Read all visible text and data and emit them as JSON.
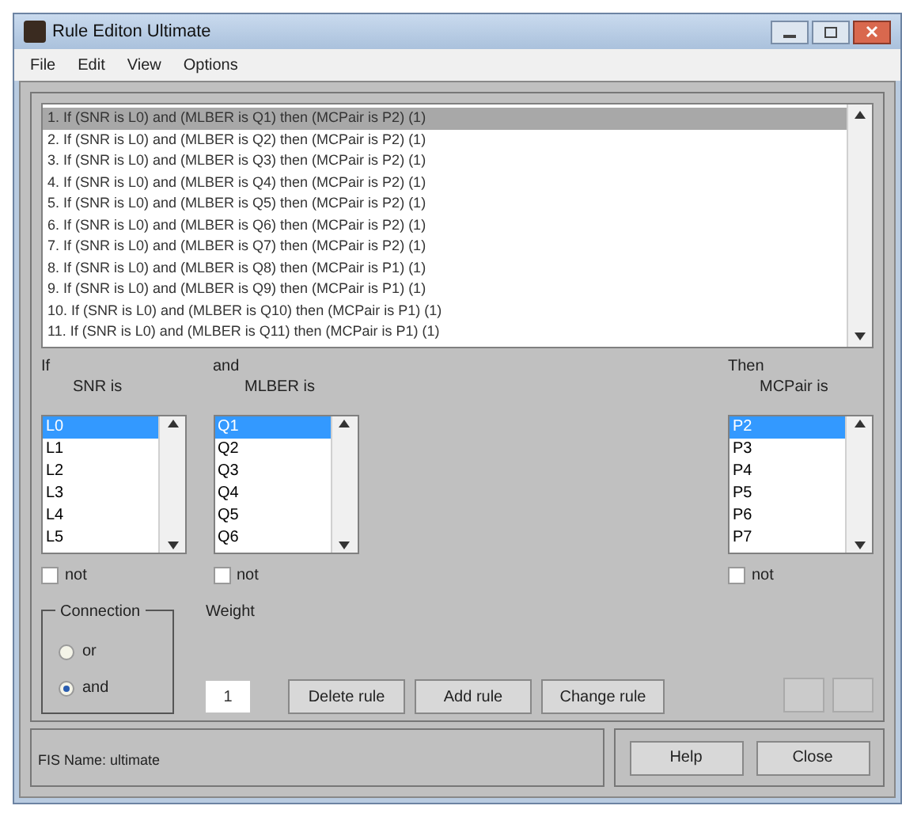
{
  "window": {
    "title": "Rule Editon Ultimate"
  },
  "menu": [
    "File",
    "Edit",
    "View",
    "Options"
  ],
  "rules": [
    {
      "text": "1. If (SNR is L0) and (MLBER is Q1) then (MCPair is P2) (1)",
      "selected": true
    },
    {
      "text": "2. If (SNR is L0) and (MLBER is Q2) then (MCPair is P2) (1)",
      "selected": false
    },
    {
      "text": "3. If (SNR is L0) and (MLBER is Q3) then (MCPair is P2) (1)",
      "selected": false
    },
    {
      "text": "4. If (SNR is L0) and (MLBER is Q4) then (MCPair is P2) (1)",
      "selected": false
    },
    {
      "text": "5. If (SNR is L0) and (MLBER is Q5) then (MCPair is P2) (1)",
      "selected": false
    },
    {
      "text": "6. If (SNR is L0) and (MLBER is Q6) then (MCPair is P2) (1)",
      "selected": false
    },
    {
      "text": "7. If (SNR is L0) and (MLBER is Q7) then (MCPair is P2) (1)",
      "selected": false
    },
    {
      "text": "8. If (SNR is L0) and (MLBER is Q8) then (MCPair is P1) (1)",
      "selected": false
    },
    {
      "text": "9. If (SNR is L0) and (MLBER is Q9) then (MCPair is P1) (1)",
      "selected": false
    },
    {
      "text": "10. If (SNR is L0) and (MLBER is Q10) then (MCPair is P1) (1)",
      "selected": false
    },
    {
      "text": "11. If (SNR is L0) and (MLBER is Q11) then (MCPair is P1) (1)",
      "selected": false
    }
  ],
  "if_label": "If",
  "and_label": "and",
  "then_label": "Then",
  "variables": [
    {
      "label": "SNR is",
      "items": [
        {
          "text": "L0",
          "selected": true
        },
        {
          "text": "L1",
          "selected": false
        },
        {
          "text": "L2",
          "selected": false
        },
        {
          "text": "L3",
          "selected": false
        },
        {
          "text": "L4",
          "selected": false
        },
        {
          "text": "L5",
          "selected": false
        }
      ],
      "not": {
        "label": "not",
        "checked": false
      }
    },
    {
      "label": "MLBER is",
      "items": [
        {
          "text": "Q1",
          "selected": true
        },
        {
          "text": "Q2",
          "selected": false
        },
        {
          "text": "Q3",
          "selected": false
        },
        {
          "text": "Q4",
          "selected": false
        },
        {
          "text": "Q5",
          "selected": false
        },
        {
          "text": "Q6",
          "selected": false
        }
      ],
      "not": {
        "label": "not",
        "checked": false
      }
    },
    {
      "label": "MCPair is",
      "items": [
        {
          "text": "P2",
          "selected": true
        },
        {
          "text": "P3",
          "selected": false
        },
        {
          "text": "P4",
          "selected": false
        },
        {
          "text": "P5",
          "selected": false
        },
        {
          "text": "P6",
          "selected": false
        },
        {
          "text": "P7",
          "selected": false
        }
      ],
      "not": {
        "label": "not",
        "checked": false
      }
    }
  ],
  "connection": {
    "title": "Connection",
    "options": [
      {
        "label": "or",
        "selected": false
      },
      {
        "label": "and",
        "selected": true
      }
    ]
  },
  "weight": {
    "label": "Weight",
    "value": "1"
  },
  "buttons": [
    "Delete rule",
    "Add rule",
    "Change rule"
  ],
  "status": "FIS Name: ultimate",
  "footer_buttons": [
    "Help",
    "Close"
  ]
}
